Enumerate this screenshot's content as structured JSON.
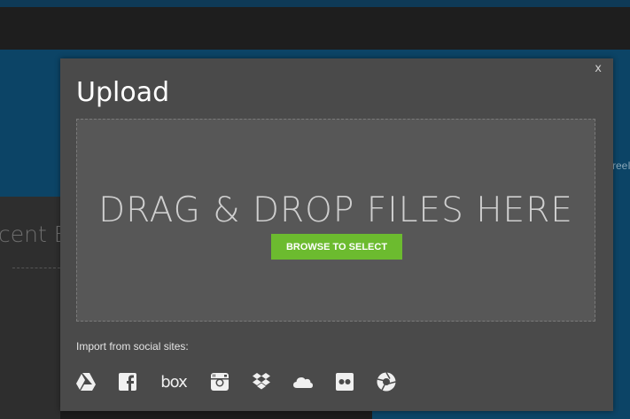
{
  "background": {
    "banner_text": "reeI",
    "left_panel_text": "cent E"
  },
  "modal": {
    "title": "Upload",
    "close_label": "x",
    "dropzone": {
      "heading": "DRAG & DROP FILES HERE",
      "browse_label": "BROWSE TO SELECT"
    },
    "import_label": "Import from social sites:",
    "social_sites": [
      {
        "icon": "google-drive-icon"
      },
      {
        "icon": "facebook-icon"
      },
      {
        "icon": "box-icon",
        "text": "box"
      },
      {
        "icon": "instagram-icon"
      },
      {
        "icon": "dropbox-icon"
      },
      {
        "icon": "onedrive-icon"
      },
      {
        "icon": "flickr-icon"
      },
      {
        "icon": "picasa-icon"
      }
    ]
  },
  "colors": {
    "modal_bg": "#4a4a4a",
    "dropzone_bg": "#575757",
    "accent_green": "#6cbb2f",
    "banner_blue": "#0c4466"
  }
}
